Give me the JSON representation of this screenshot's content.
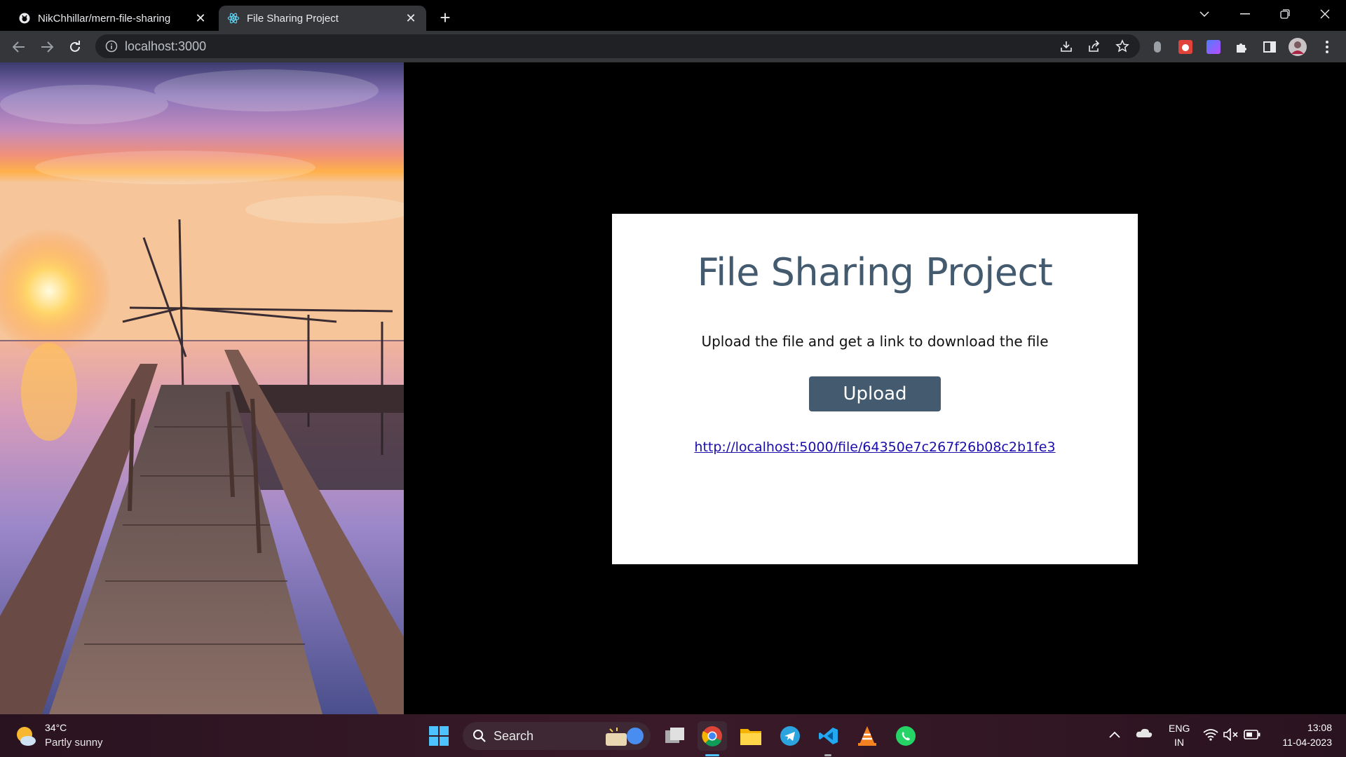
{
  "browser": {
    "tabs": [
      {
        "title": "NikChhillar/mern-file-sharing",
        "favicon": "github-icon",
        "active": false
      },
      {
        "title": "File Sharing Project",
        "favicon": "react-icon",
        "active": true
      }
    ],
    "url": "localhost:3000"
  },
  "page": {
    "title": "File Sharing Project",
    "subtitle": "Upload the file and get a link to download the file",
    "upload_label": "Upload",
    "link": "http://localhost:5000/file/64350e7c267f26b08c2b1fe3",
    "colors": {
      "accent": "#445a6f",
      "link": "#1a0dab"
    }
  },
  "taskbar": {
    "weather_temp": "34°C",
    "weather_desc": "Partly sunny",
    "search_label": "Search",
    "lang_primary": "ENG",
    "lang_secondary": "IN",
    "time": "13:08",
    "date": "11-04-2023"
  }
}
